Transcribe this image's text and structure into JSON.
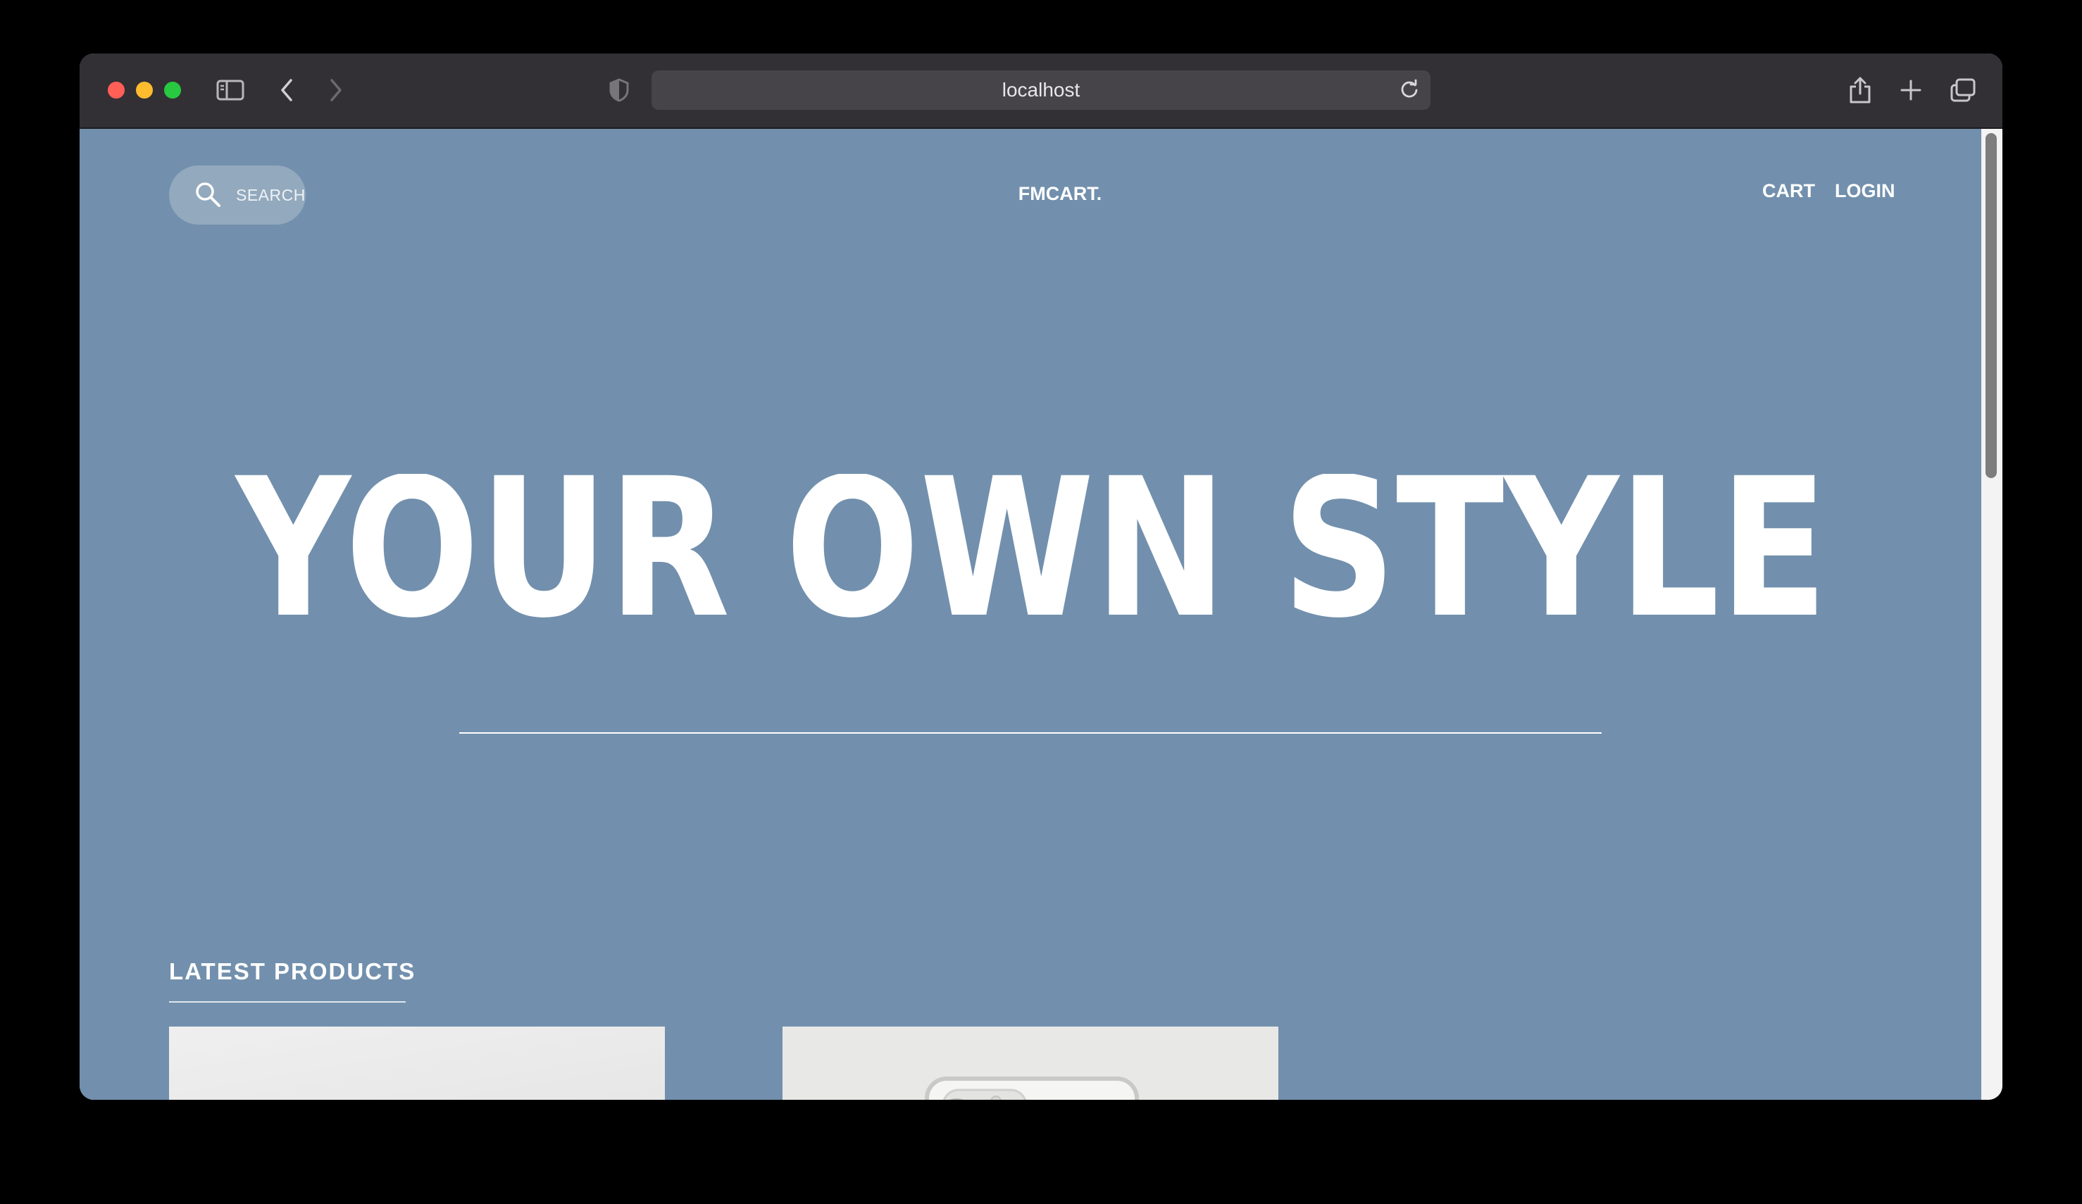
{
  "browser": {
    "url": "localhost"
  },
  "header": {
    "search_label": "SEARCH",
    "brand": "FMCART.",
    "nav": {
      "cart": "CART",
      "login": "LOGIN"
    }
  },
  "hero": {
    "headline": "YOUR OWN STYLE"
  },
  "products": {
    "section_title": "LATEST PRODUCTS",
    "items": [
      {
        "image": "product-photo-plain"
      },
      {
        "image": "smartphone-rear-camera-photo"
      }
    ]
  },
  "colors": {
    "page_background": "#7290ad",
    "text": "#ffffff",
    "browser_chrome": "#323034"
  }
}
